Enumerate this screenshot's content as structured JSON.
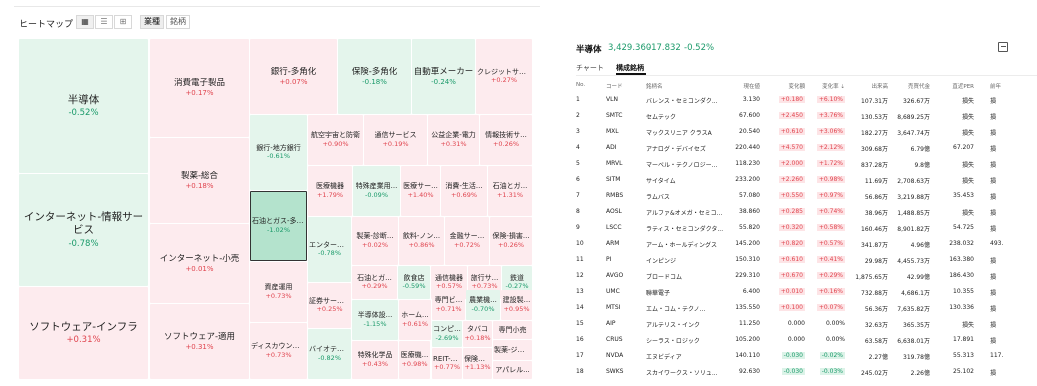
{
  "heatmap": {
    "title": "ヒートマップ",
    "view_icons": [
      "treemap-view-icon",
      "list-view-icon",
      "grid-view-icon"
    ],
    "tabs": [
      "業種",
      "銘柄"
    ],
    "active_tab": "業種",
    "cells": [
      {
        "name": "半導体",
        "change": "-0.52%",
        "dir": "dn",
        "size": "big"
      },
      {
        "name": "インターネット-情報サービス",
        "change": "-0.78%",
        "dir": "dn",
        "size": "big"
      },
      {
        "name": "ソフトウェア-インフラ",
        "change": "+0.31%",
        "dir": "up",
        "size": "big"
      },
      {
        "name": "消費電子製品",
        "change": "+0.17%",
        "dir": "up",
        "size": "mid"
      },
      {
        "name": "製薬-総合",
        "change": "+0.18%",
        "dir": "up",
        "size": "mid"
      },
      {
        "name": "インターネット-小売",
        "change": "+0.01%",
        "dir": "up",
        "size": "mid"
      },
      {
        "name": "ソフトウェア-適用",
        "change": "+0.31%",
        "dir": "up",
        "size": "mid"
      },
      {
        "name": "銀行-多角化",
        "change": "+0.07%",
        "dir": "up",
        "size": "mid"
      },
      {
        "name": "保険-多角化",
        "change": "-0.18%",
        "dir": "dn",
        "size": "mid"
      },
      {
        "name": "自動車メーカー",
        "change": "-0.24%",
        "dir": "dn",
        "size": "mid"
      },
      {
        "name": "クレジットサービス",
        "change": "+0.27%",
        "dir": "up",
        "size": "sm"
      },
      {
        "name": "銀行-地方銀行",
        "change": "-0.61%",
        "dir": "dn",
        "size": "sm"
      },
      {
        "name": "石油とガス-多角化",
        "change": "-1.02%",
        "dir": "dn",
        "size": "sm"
      },
      {
        "name": "資産運用",
        "change": "+0.73%",
        "dir": "up",
        "size": "sm"
      },
      {
        "name": "ディスカウントストア",
        "change": "+0.73%",
        "dir": "up",
        "size": "sm"
      },
      {
        "name": "航空宇宙と防衛",
        "change": "+0.90%",
        "dir": "up",
        "size": "sm"
      },
      {
        "name": "通信サービス",
        "change": "+0.19%",
        "dir": "up",
        "size": "sm"
      },
      {
        "name": "公益企業-電力",
        "change": "+0.31%",
        "dir": "up",
        "size": "sm"
      },
      {
        "name": "情報技術サ...",
        "change": "+0.26%",
        "dir": "up",
        "size": "sm"
      },
      {
        "name": "医療機器",
        "change": "+1.79%",
        "dir": "up",
        "size": "sm"
      },
      {
        "name": "特殊産業用...",
        "change": "-0.09%",
        "dir": "dn",
        "size": "sm"
      },
      {
        "name": "医療サー...",
        "change": "+1.40%",
        "dir": "up",
        "size": "sm"
      },
      {
        "name": "消費-生活...",
        "change": "+0.69%",
        "dir": "up",
        "size": "sm"
      },
      {
        "name": "石油とガ...",
        "change": "+1.31%",
        "dir": "up",
        "size": "sm"
      },
      {
        "name": "エンターテ...",
        "change": "-0.78%",
        "dir": "dn",
        "size": "sm"
      },
      {
        "name": "製薬-診断...",
        "change": "+0.02%",
        "dir": "up",
        "size": "sm"
      },
      {
        "name": "飲料-ノン...",
        "change": "+0.86%",
        "dir": "up",
        "size": "sm"
      },
      {
        "name": "金融サー...",
        "change": "+0.72%",
        "dir": "up",
        "size": "sm"
      },
      {
        "name": "保険-損害...",
        "change": "+0.26%",
        "dir": "up",
        "size": "sm"
      },
      {
        "name": "石油とガ...",
        "change": "+0.29%",
        "dir": "up",
        "size": "sm"
      },
      {
        "name": "飲食店",
        "change": "-0.59%",
        "dir": "dn",
        "size": "sm"
      },
      {
        "name": "通信機器",
        "change": "+0.57%",
        "dir": "up",
        "size": "sm"
      },
      {
        "name": "旅行サ...",
        "change": "+0.73%",
        "dir": "up",
        "size": "sm"
      },
      {
        "name": "鉄道",
        "change": "-0.27%",
        "dir": "dn",
        "size": "sm"
      },
      {
        "name": "証券サービ...",
        "change": "+0.25%",
        "dir": "up",
        "size": "sm"
      },
      {
        "name": "半導体設...",
        "change": "-1.15%",
        "dir": "dn",
        "size": "sm"
      },
      {
        "name": "ホーム...",
        "change": "+0.61%",
        "dir": "up",
        "size": "sm"
      },
      {
        "name": "専門ビ...",
        "change": "+0.71%",
        "dir": "up",
        "size": "sm"
      },
      {
        "name": "農業機...",
        "change": "-0.70%",
        "dir": "dn",
        "size": "sm"
      },
      {
        "name": "建設製...",
        "change": "+0.95%",
        "dir": "up",
        "size": "sm"
      },
      {
        "name": "コンピ...",
        "change": "-2.69%",
        "dir": "dn",
        "size": "sm"
      },
      {
        "name": "タバコ",
        "change": "+0.18%",
        "dir": "up",
        "size": "sm"
      },
      {
        "name": "専門小売",
        "change": "",
        "dir": "up",
        "size": "sm"
      },
      {
        "name": "バイオテク...",
        "change": "-0.82%",
        "dir": "dn",
        "size": "sm"
      },
      {
        "name": "特殊化学品",
        "change": "+0.43%",
        "dir": "up",
        "size": "sm"
      },
      {
        "name": "医療機...",
        "change": "+0.98%",
        "dir": "up",
        "size": "sm"
      },
      {
        "name": "REIT-特...",
        "change": "+0.77%",
        "dir": "up",
        "size": "sm"
      },
      {
        "name": "保険仲...",
        "change": "+1.13%",
        "dir": "up",
        "size": "sm"
      },
      {
        "name": "製薬-ジェ...",
        "change": "",
        "dir": "up",
        "size": "sm"
      },
      {
        "name": "アパレル...",
        "change": "",
        "dir": "up",
        "size": "sm"
      }
    ]
  },
  "sector": {
    "name": "半導体",
    "price": "3,429.360",
    "change": "-17.832",
    "pct": "-0.52%",
    "tabs": [
      "チャート",
      "構成銘柄"
    ],
    "active_tab": "構成銘柄"
  },
  "table": {
    "headers": [
      "No.",
      "コード",
      "銘柄名",
      "現在値",
      "変化額",
      "変化率 ⇣",
      "出来高",
      "売買代金",
      "直近PER",
      "前年"
    ],
    "rows": [
      {
        "no": "1",
        "code": "VLN",
        "name": "バレンス・セミコンダク...",
        "price": "3.130",
        "chg": "+0.180",
        "pct": "+6.10%",
        "vol": "107.31万",
        "turnover": "326.67万",
        "per": "損失",
        "dir": "up"
      },
      {
        "no": "2",
        "code": "SMTC",
        "name": "セムテック",
        "price": "67.600",
        "chg": "+2.450",
        "pct": "+3.76%",
        "vol": "130.53万",
        "turnover": "8,689.25万",
        "per": "損失",
        "dir": "up"
      },
      {
        "no": "3",
        "code": "MXL",
        "name": "マックスリニア クラスA",
        "price": "20.540",
        "chg": "+0.610",
        "pct": "+3.06%",
        "vol": "182.27万",
        "turnover": "3,647.74万",
        "per": "損失",
        "dir": "up"
      },
      {
        "no": "4",
        "code": "ADI",
        "name": "アナログ・デバイセズ",
        "price": "220.440",
        "chg": "+4.570",
        "pct": "+2.12%",
        "vol": "309.68万",
        "turnover": "6.79億",
        "per": "67.207",
        "dir": "up"
      },
      {
        "no": "5",
        "code": "MRVL",
        "name": "マーベル・テクノロジー...",
        "price": "118.230",
        "chg": "+2.000",
        "pct": "+1.72%",
        "vol": "837.28万",
        "turnover": "9.8億",
        "per": "損失",
        "dir": "up"
      },
      {
        "no": "6",
        "code": "SITM",
        "name": "サイタイム",
        "price": "233.200",
        "chg": "+2.260",
        "pct": "+0.98%",
        "vol": "11.69万",
        "turnover": "2,708.63万",
        "per": "損失",
        "dir": "up"
      },
      {
        "no": "7",
        "code": "RMBS",
        "name": "ラムバス",
        "price": "57.080",
        "chg": "+0.550",
        "pct": "+0.97%",
        "vol": "56.86万",
        "turnover": "3,219.88万",
        "per": "35.453",
        "dir": "up"
      },
      {
        "no": "8",
        "code": "AOSL",
        "name": "アルファ&オメガ・セミコ...",
        "price": "38.860",
        "chg": "+0.285",
        "pct": "+0.74%",
        "vol": "38.96万",
        "turnover": "1,488.85万",
        "per": "損失",
        "dir": "up"
      },
      {
        "no": "9",
        "code": "LSCC",
        "name": "ラティス・セミコンダクタ...",
        "price": "55.820",
        "chg": "+0.320",
        "pct": "+0.58%",
        "vol": "160.46万",
        "turnover": "8,901.82万",
        "per": "54.725",
        "dir": "up"
      },
      {
        "no": "10",
        "code": "ARM",
        "name": "アーム・ホールディングス",
        "price": "145.200",
        "chg": "+0.820",
        "pct": "+0.57%",
        "vol": "341.87万",
        "turnover": "4.96億",
        "per": "238.032",
        "dir": "up"
      },
      {
        "no": "11",
        "code": "PI",
        "name": "インピンジ",
        "price": "150.310",
        "chg": "+0.610",
        "pct": "+0.41%",
        "vol": "29.98万",
        "turnover": "4,455.73万",
        "per": "163.380",
        "dir": "up"
      },
      {
        "no": "12",
        "code": "AVGO",
        "name": "ブロードコム",
        "price": "229.310",
        "chg": "+0.670",
        "pct": "+0.29%",
        "vol": "1,875.65万",
        "turnover": "42.99億",
        "per": "186.430",
        "dir": "up"
      },
      {
        "no": "13",
        "code": "UMC",
        "name": "聯華電子",
        "price": "6.400",
        "chg": "+0.010",
        "pct": "+0.16%",
        "vol": "732.88万",
        "turnover": "4,686.1万",
        "per": "10.355",
        "dir": "up"
      },
      {
        "no": "14",
        "code": "MTSI",
        "name": "エム・コム・テクノ...",
        "price": "135.550",
        "chg": "+0.100",
        "pct": "+0.07%",
        "vol": "56.36万",
        "turnover": "7,635.82万",
        "per": "130.336",
        "dir": "up"
      },
      {
        "no": "15",
        "code": "AIP",
        "name": "アルテリス・インク",
        "price": "11.250",
        "chg": "0.000",
        "pct": "0.00%",
        "vol": "32.63万",
        "turnover": "365.35万",
        "per": "損失",
        "dir": "flat"
      },
      {
        "no": "16",
        "code": "CRUS",
        "name": "シーラス・ロジック",
        "price": "105.200",
        "chg": "0.000",
        "pct": "0.00%",
        "vol": "63.58万",
        "turnover": "6,638.01万",
        "per": "17.891",
        "dir": "flat"
      },
      {
        "no": "17",
        "code": "NVDA",
        "name": "エヌビディア",
        "price": "140.110",
        "chg": "-0.030",
        "pct": "-0.02%",
        "vol": "2.27億",
        "turnover": "319.78億",
        "per": "55.313",
        "dir": "dn"
      },
      {
        "no": "18",
        "code": "SWKS",
        "name": "スカイワークス・ソリュ...",
        "price": "92.630",
        "chg": "-0.030",
        "pct": "-0.03%",
        "vol": "245.02万",
        "turnover": "2.26億",
        "per": "25.102",
        "dir": "dn"
      }
    ],
    "cutoff_values": [
      "損",
      "損",
      "損",
      "損",
      "損",
      "損",
      "損",
      "損",
      "損",
      "493.",
      "損",
      "損",
      "損",
      "損",
      "損",
      "損",
      "117.",
      "損"
    ]
  },
  "colors": {
    "up_text": "#e0454f",
    "down_text": "#1b9a6a",
    "up_bg": "#fdebee",
    "down_bg": "#e4f5ec",
    "selected_bg": "#b4e3cd"
  }
}
